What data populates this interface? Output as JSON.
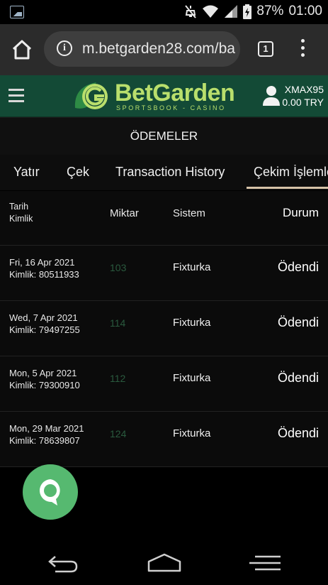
{
  "status_bar": {
    "battery": "87%",
    "time": "01:00"
  },
  "browser": {
    "url": "m.betgarden28.com/ba",
    "tab_count": "1"
  },
  "header": {
    "logo_text": "BetGarden",
    "logo_subtitle": "SPORTSBOOK - CASINO",
    "username": "XMAX95",
    "balance": "0.00 TRY"
  },
  "page": {
    "title": "ÖDEMELER"
  },
  "tabs": [
    {
      "label": "Yatır"
    },
    {
      "label": "Çek"
    },
    {
      "label": "Transaction History"
    },
    {
      "label": "Çekim İşlemleri"
    }
  ],
  "table": {
    "headers": {
      "date": "Tarih",
      "id": "Kimlik",
      "amount": "Miktar",
      "system": "Sistem",
      "status": "Durum"
    },
    "rows": [
      {
        "date": "Fri, 16 Apr 2021",
        "id": "Kimlik: 80511933",
        "amount": "103",
        "system": "Fixturka",
        "status": "Ödendi"
      },
      {
        "date": "Wed, 7 Apr 2021",
        "id": "Kimlik: 79497255",
        "amount": "114",
        "system": "Fixturka",
        "status": "Ödendi"
      },
      {
        "date": "Mon, 5 Apr 2021",
        "id": "Kimlik: 79300910",
        "amount": "112",
        "system": "Fixturka",
        "status": "Ödendi"
      },
      {
        "date": "Mon, 29 Mar 2021",
        "id": "Kimlik: 78639807",
        "amount": "124",
        "system": "Fixturka",
        "status": "Ödendi"
      }
    ]
  },
  "colors": {
    "header_bg": "#134a36",
    "logo": "#b9df6c",
    "amount_text": "#2a5a3e",
    "active_tab_underline": "#d6c3a8",
    "chat_button": "#56b970"
  },
  "icons": {
    "status_left": "gallery-icon",
    "mute": "mute-icon",
    "wifi": "wifi-icon",
    "signal": "signal-icon",
    "battery": "battery-icon",
    "home": "home-icon",
    "info": "info-icon",
    "menu": "more-vert-icon",
    "hamburger": "hamburger-icon",
    "user": "user-icon",
    "chat": "chat-icon",
    "back": "back-icon",
    "nav_home": "nav-home-icon",
    "recents": "recents-icon"
  }
}
